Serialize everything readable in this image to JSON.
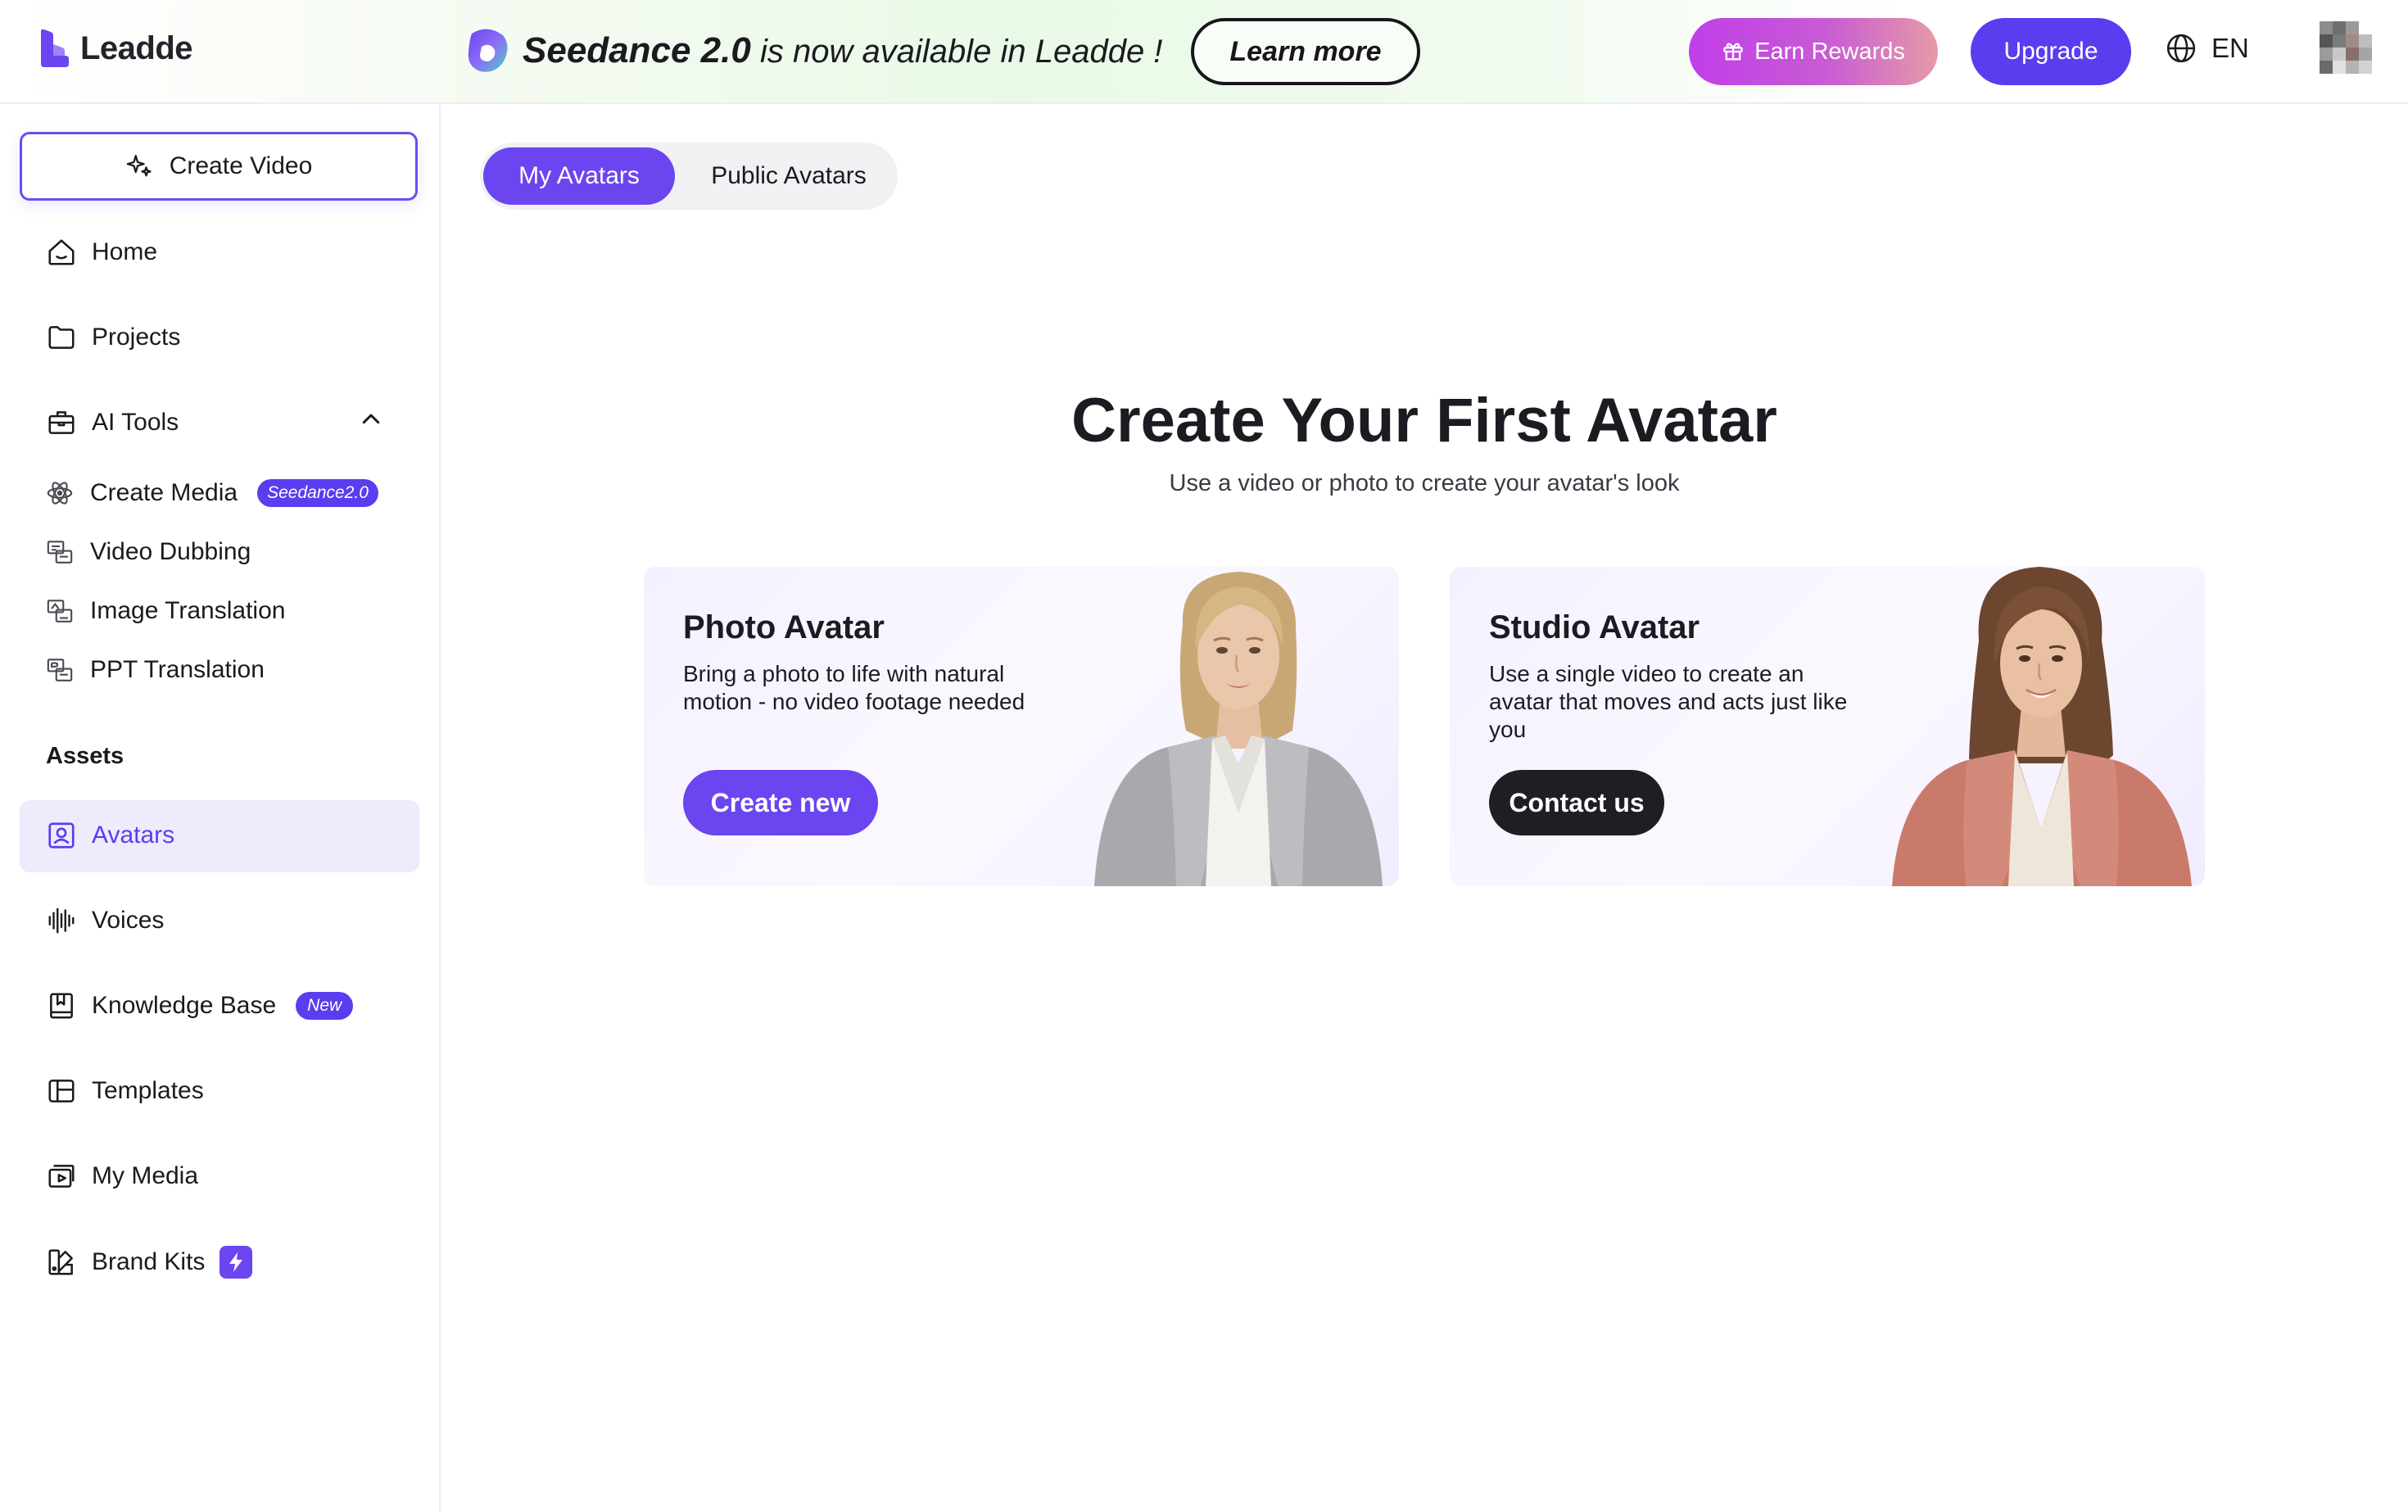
{
  "app": {
    "name": "Leadde"
  },
  "header": {
    "promo_brand": "Seedance 2.0",
    "promo_message": " is now available in Leadde !",
    "learn_more": "Learn more",
    "earn_rewards": "Earn Rewards",
    "upgrade": "Upgrade",
    "language": "EN"
  },
  "sidebar": {
    "create_video": "Create Video",
    "home": "Home",
    "projects": "Projects",
    "ai_tools": "AI Tools",
    "ai_tools_expanded": true,
    "create_media": "Create Media",
    "create_media_badge": "Seedance2.0",
    "video_dubbing": "Video Dubbing",
    "image_translation": "Image Translation",
    "ppt_translation": "PPT Translation",
    "assets_label": "Assets",
    "avatars": "Avatars",
    "voices": "Voices",
    "knowledge_base": "Knowledge Base",
    "knowledge_base_badge": "New",
    "templates": "Templates",
    "my_media": "My Media",
    "brand_kits": "Brand Kits",
    "active_item": "Avatars"
  },
  "tabs": {
    "my_avatars": "My Avatars",
    "public_avatars": "Public Avatars",
    "active": "My Avatars"
  },
  "hero": {
    "title": "Create Your First Avatar",
    "subtitle": "Use a video or photo to create your avatar's look"
  },
  "cards": [
    {
      "title": "Photo Avatar",
      "description": "Bring a photo to life with natural motion - no video footage needed",
      "button": "Create new"
    },
    {
      "title": "Studio Avatar",
      "description": "Use a single video to create an avatar that moves and acts just like you",
      "button": "Contact us"
    }
  ],
  "colors": {
    "accent": "#5a3dee",
    "accent_light": "#efebfd",
    "dark_button": "#1e1e24",
    "earn_gradient_start": "#c03ee8",
    "earn_gradient_end": "#e69aa6"
  }
}
